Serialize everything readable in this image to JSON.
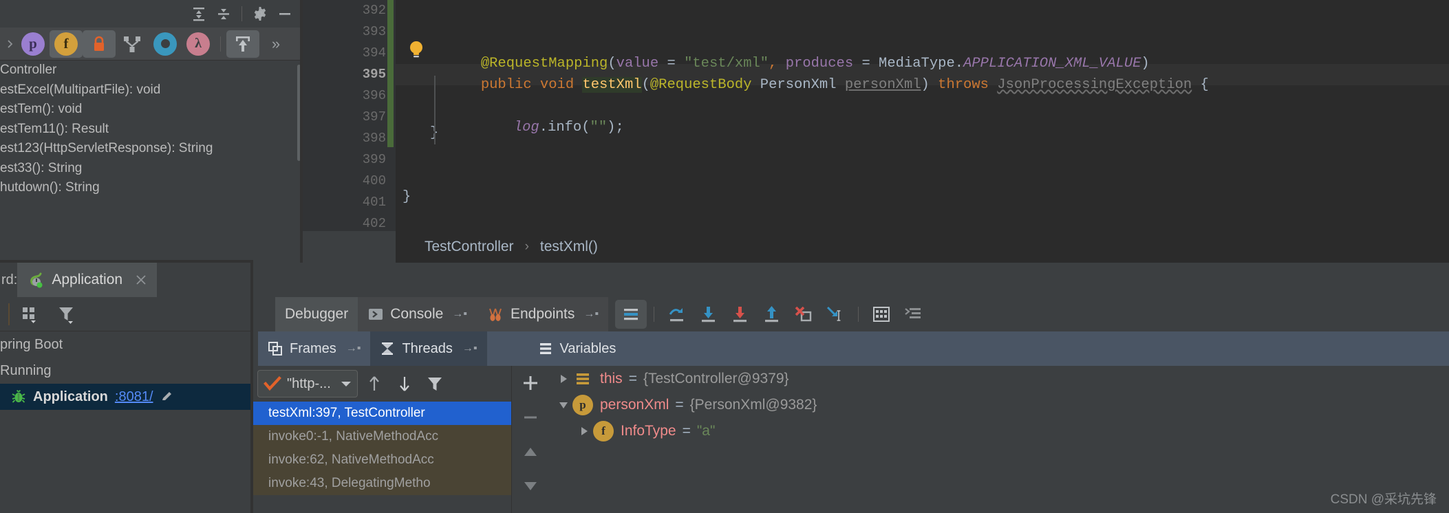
{
  "window": {
    "title": "IntelliJ IDEA Debugger"
  },
  "structure": {
    "toolbar": {
      "expand_all": "expand-all-icon",
      "collapse_all": "collapse-all-icon",
      "settings": "gear-icon",
      "hide": "minimize-icon"
    },
    "filters": [
      {
        "name": "properties-filter",
        "glyph": "p",
        "bg": "#9a7fd0",
        "fg": "#3b2f58",
        "active": false
      },
      {
        "name": "fields-filter",
        "glyph": "f",
        "bg": "#d3a03c",
        "fg": "#3b2f10",
        "active": true
      },
      {
        "name": "non-public-filter",
        "glyph": "lock",
        "bg": "#7a7d7f",
        "fg": "#e2622a",
        "active": true
      },
      {
        "name": "inherited-filter",
        "glyph": "Y",
        "bg": "#a9adb0",
        "fg": "#3c3f41",
        "active": false
      },
      {
        "name": "anonymous-filter",
        "glyph": "O",
        "bg": "#3a97bd",
        "fg": "#3c3f41",
        "active": false
      },
      {
        "name": "lambda-filter",
        "glyph": "λ",
        "bg": "#c87e8e",
        "fg": "#3c3f41",
        "active": false
      },
      {
        "name": "autoscroll-filter",
        "glyph": "export",
        "bg": "#5d6164",
        "fg": "#bbbbbb",
        "active": true
      }
    ],
    "overflow_label": "»",
    "items": [
      "Controller",
      "estExcel(MultipartFile): void",
      "estTem(): void",
      "estTem11(): Result",
      "est123(HttpServletResponse): String",
      "est33(): String",
      "hutdown(): String"
    ]
  },
  "editor": {
    "line_numbers": [
      "392",
      "393",
      "394",
      "395",
      "396",
      "397",
      "398",
      "399",
      "400",
      "401",
      "402"
    ],
    "current_line": "395",
    "code": {
      "line394": {
        "annotation": "@RequestMapping",
        "paren_open": "(",
        "param1": "value",
        "eq": " = ",
        "str1": "\"test/xml\"",
        "comma": ", ",
        "param2": "produces",
        "eq2": " = ",
        "type": "MediaType.",
        "constant": "APPLICATION_XML_VALUE",
        "paren_close": ")"
      },
      "line395": {
        "modifier": "public void ",
        "method": "testXml",
        "paren": "(",
        "annotation": "@RequestBody",
        "type": " PersonXml ",
        "param": "personXml",
        "close": ") ",
        "throws": "throws ",
        "exception": "JsonProcessingException",
        "brace": " {"
      },
      "line397": {
        "logger": "log",
        "call": ".info(",
        "str": "\"\"",
        "end": ");"
      },
      "line398": {
        "brace": "}"
      },
      "line401": {
        "brace": "}"
      }
    },
    "breadcrumb": {
      "class": "TestController",
      "separator": "›",
      "method": "testXml()"
    }
  },
  "services": {
    "tab_prefix_label": "rd:",
    "tab_name": "Application",
    "tab_close": "close-icon",
    "toolbar": {
      "group_by": "group-by-icon",
      "filter": "filter-icon"
    },
    "tree": [
      {
        "label": "pring Boot",
        "selected": false,
        "icon": null
      },
      {
        "label": "Running",
        "selected": false,
        "icon": null
      },
      {
        "label": "Application",
        "selected": true,
        "icon": "debug-bug-icon",
        "link": ":8081/",
        "edit": "pencil-icon"
      }
    ]
  },
  "debugger": {
    "tabs": [
      {
        "label": "Debugger",
        "icon": null,
        "active": true,
        "pin": false
      },
      {
        "label": "Console",
        "icon": "console-icon",
        "active": false,
        "pin": true
      },
      {
        "label": "Endpoints",
        "icon": "endpoints-icon",
        "active": false,
        "pin": true
      }
    ],
    "toolbar": [
      {
        "name": "layout-settings-button",
        "icon": "lines-icon",
        "active": true
      },
      {
        "name": "step-over-button",
        "icon": "step-over-icon",
        "active": false
      },
      {
        "name": "step-into-button",
        "icon": "step-into-icon",
        "active": false
      },
      {
        "name": "force-step-into-button",
        "icon": "force-step-into-icon",
        "active": false
      },
      {
        "name": "step-out-button",
        "icon": "step-out-icon",
        "active": false
      },
      {
        "name": "drop-frame-button",
        "icon": "drop-frame-icon",
        "active": false
      },
      {
        "name": "run-to-cursor-button",
        "icon": "run-to-cursor-icon",
        "active": false
      },
      {
        "name": "evaluate-expression-button",
        "icon": "calculator-icon",
        "active": false
      },
      {
        "name": "show-execution-point-button",
        "icon": "execution-point-icon",
        "active": false
      }
    ],
    "subtabs": [
      {
        "label": "Frames",
        "icon": "frames-icon",
        "pin": true,
        "dark": false
      },
      {
        "label": "Threads",
        "icon": "threads-icon",
        "pin": true,
        "dark": true
      },
      {
        "label": "Variables",
        "icon": "variables-icon",
        "pin": false,
        "dark": false
      }
    ],
    "frames": {
      "thread_selector": {
        "value": "\"http-...",
        "check": "check-icon",
        "chevron": "chevron-down-icon"
      },
      "up_button": "arrow-up-icon",
      "down_button": "arrow-down-icon",
      "filter_button": "filter-icon",
      "stack": [
        {
          "label": "testXml:397, TestController",
          "selected": true
        },
        {
          "label": "invoke0:-1, NativeMethodAcc",
          "selected": false
        },
        {
          "label": "invoke:62, NativeMethodAcc",
          "selected": false
        },
        {
          "label": "invoke:43, DelegatingMetho",
          "selected": false
        }
      ]
    },
    "frames_sidebar": [
      {
        "name": "add-watch-button",
        "icon": "plus-icon"
      },
      {
        "name": "remove-watch-button",
        "icon": "minus-icon"
      },
      {
        "name": "move-up-button",
        "icon": "triangle-up-icon"
      },
      {
        "name": "move-down-button",
        "icon": "triangle-down-icon"
      }
    ],
    "variables": [
      {
        "indent": 0,
        "expanded": false,
        "icon": "object-icon",
        "icon_glyph": "≡",
        "icon_bg": "#c79a3a",
        "name": "this",
        "value": "{TestController@9379}",
        "is_string": false
      },
      {
        "indent": 0,
        "expanded": true,
        "icon": "parameter-icon",
        "icon_glyph": "p",
        "icon_bg": "#c79a3a",
        "name": "personXml",
        "value": "{PersonXml@9382}",
        "is_string": false
      },
      {
        "indent": 1,
        "expanded": false,
        "icon": "field-icon",
        "icon_glyph": "f",
        "icon_bg": "#c79a3a",
        "name": "InfoType",
        "value": "\"a\"",
        "is_string": true
      }
    ]
  },
  "watermark": {
    "text": "CSDN @采坑先锋"
  },
  "colors": {
    "editor_bg": "#2b2b2b",
    "panel_bg": "#3c3f41",
    "gutter_bg": "#313335",
    "selection_blue": "#2161cf",
    "subtab_bar": "#4a5564",
    "accent_orange": "#cc7832",
    "accent_green": "#6a8759",
    "link_blue": "#548af7"
  }
}
